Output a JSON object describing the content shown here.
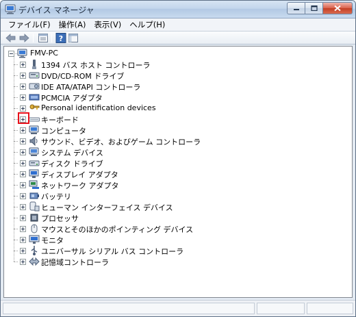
{
  "window": {
    "title": "デバイス マネージャ"
  },
  "menu": [
    {
      "label": "ファイル(F)"
    },
    {
      "label": "操作(A)"
    },
    {
      "label": "表示(V)"
    },
    {
      "label": "ヘルプ(H)"
    }
  ],
  "toolbar": {
    "buttons": [
      "back-arrow-icon",
      "forward-arrow-icon",
      "properties-icon",
      "help-icon",
      "console-tree-icon"
    ]
  },
  "tree": {
    "root": "FMV-PC",
    "items": [
      {
        "label": "1394 バス ホスト コントローラ",
        "icon": "firewire-controller-icon"
      },
      {
        "label": "DVD/CD-ROM ドライブ",
        "icon": "dvd-drive-icon"
      },
      {
        "label": "IDE ATA/ATAPI コントローラ",
        "icon": "ide-controller-icon"
      },
      {
        "label": "PCMCIA アダプタ",
        "icon": "pcmcia-adapter-icon"
      },
      {
        "label": "Personal identification devices",
        "icon": "identification-device-icon"
      },
      {
        "label": "キーボード",
        "icon": "keyboard-icon"
      },
      {
        "label": "コンピュータ",
        "icon": "computer-icon"
      },
      {
        "label": "サウンド、ビデオ、およびゲーム コントローラ",
        "icon": "speaker-icon"
      },
      {
        "label": "システム デバイス",
        "icon": "system-device-icon"
      },
      {
        "label": "ディスク ドライブ",
        "icon": "disk-drive-icon"
      },
      {
        "label": "ディスプレイ アダプタ",
        "icon": "display-adapter-icon"
      },
      {
        "label": "ネットワーク アダプタ",
        "icon": "network-adapter-icon"
      },
      {
        "label": "バッテリ",
        "icon": "battery-icon"
      },
      {
        "label": "ヒューマン インターフェイス デバイス",
        "icon": "hid-icon"
      },
      {
        "label": "プロセッサ",
        "icon": "processor-icon"
      },
      {
        "label": "マウスとそのほかのポインティング デバイス",
        "icon": "mouse-icon"
      },
      {
        "label": "モニタ",
        "icon": "monitor-icon"
      },
      {
        "label": "ユニバーサル シリアル バス コントローラ",
        "icon": "usb-icon"
      },
      {
        "label": "記憶域コントローラ",
        "icon": "storage-controller-icon"
      }
    ]
  },
  "colors": {
    "highlight": "#e8101a",
    "titlebar": "#c3d6ec"
  }
}
